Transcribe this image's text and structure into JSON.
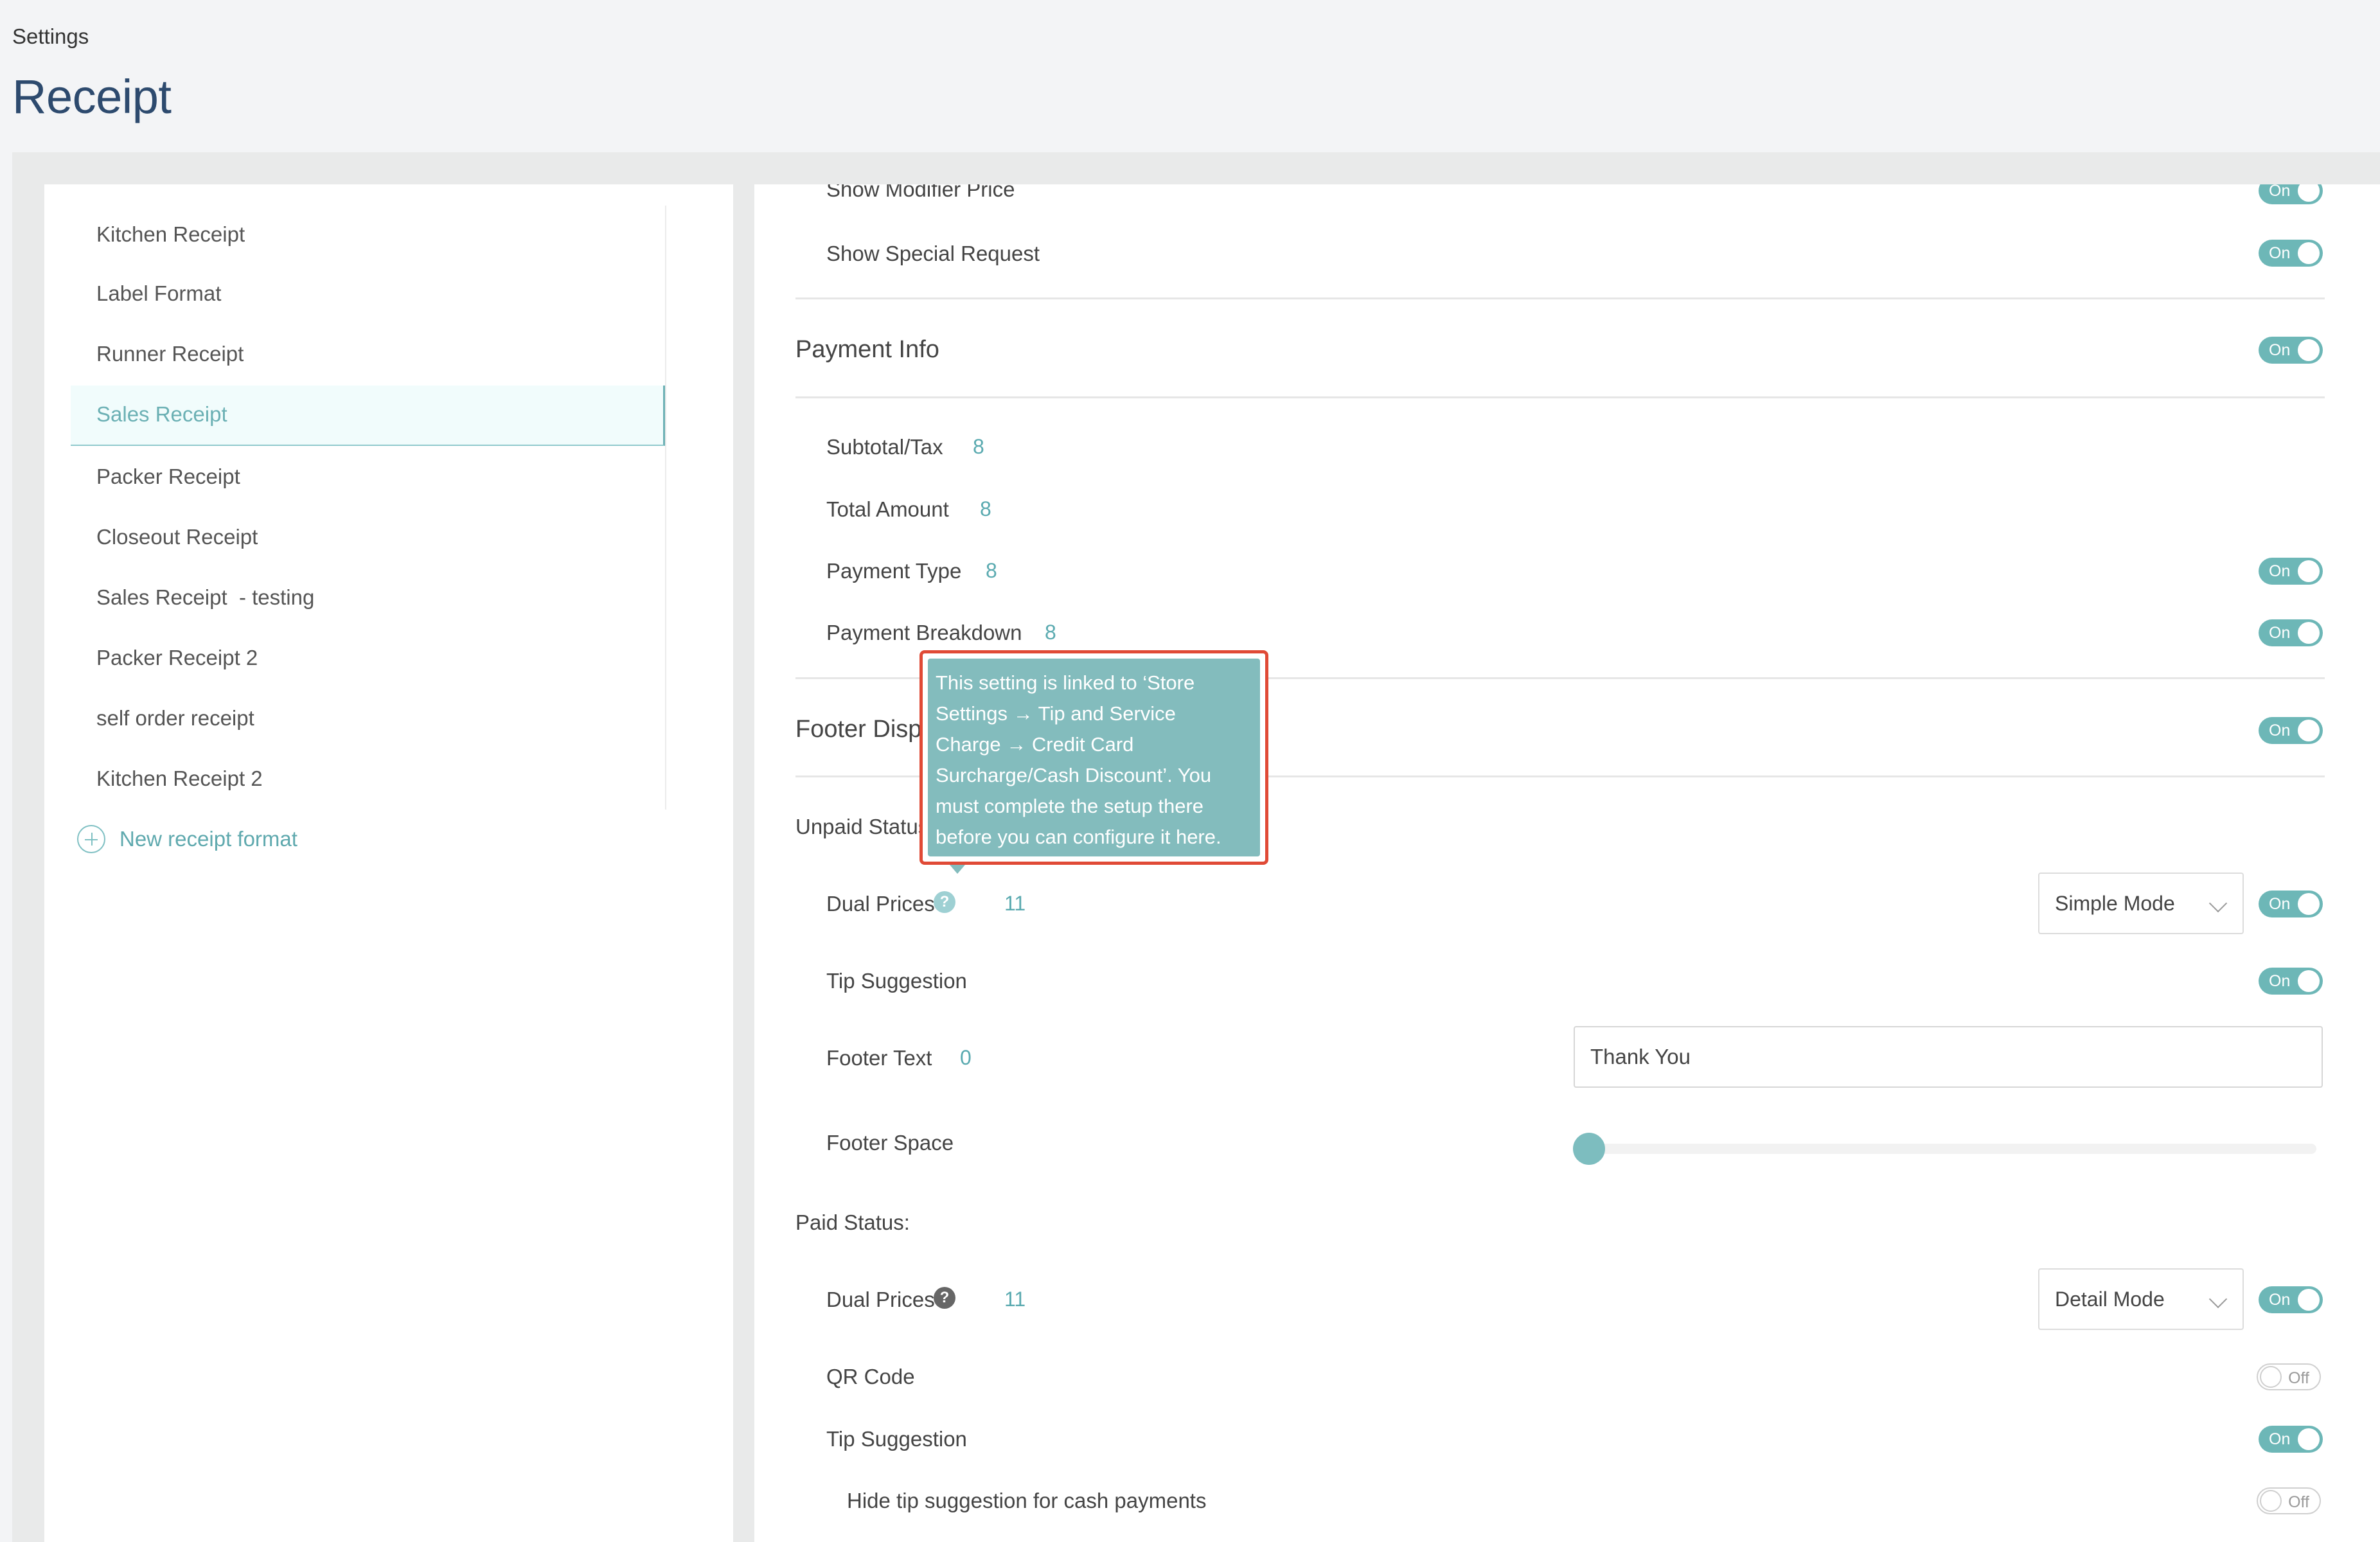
{
  "header": {
    "breadcrumb": "Settings",
    "title": "Receipt"
  },
  "sidebar": {
    "items": [
      {
        "label": "Kitchen Receipt"
      },
      {
        "label": "Label Format"
      },
      {
        "label": "Runner Receipt"
      },
      {
        "label": "Sales Receipt",
        "active": true
      },
      {
        "label": "Packer Receipt"
      },
      {
        "label": "Closeout Receipt"
      },
      {
        "label": "Sales Receipt  - testing"
      },
      {
        "label": "Packer Receipt 2"
      },
      {
        "label": "self order receipt"
      },
      {
        "label": "Kitchen Receipt 2"
      }
    ],
    "new_format_label": "New receipt format"
  },
  "toggle_text": {
    "on": "On",
    "off": "Off"
  },
  "main": {
    "show_modifier_price": {
      "label": "Show Modifier Price",
      "state": "On"
    },
    "show_special_request": {
      "label": "Show Special Request",
      "state": "On"
    },
    "payment_info": {
      "title": "Payment Info",
      "state": "On",
      "subtotal_tax": {
        "label": "Subtotal/Tax",
        "value": "8"
      },
      "total_amount": {
        "label": "Total Amount",
        "value": "8"
      },
      "payment_type": {
        "label": "Payment Type",
        "value": "8",
        "state": "On"
      },
      "payment_breakdown": {
        "label": "Payment Breakdown",
        "value": "8",
        "state": "On"
      }
    },
    "footer_display": {
      "title": "Footer Displa",
      "state": "On",
      "unpaid_status": {
        "label": "Unpaid Status:",
        "dual_prices": {
          "label": "Dual Prices",
          "value": "11",
          "mode": "Simple Mode",
          "state": "On"
        },
        "tip_suggestion": {
          "label": "Tip Suggestion",
          "state": "On"
        },
        "footer_text": {
          "label": "Footer Text",
          "value": "0",
          "input_value": "Thank You"
        },
        "footer_space": {
          "label": "Footer Space",
          "level": 0
        }
      },
      "paid_status": {
        "label": "Paid Status:",
        "dual_prices": {
          "label": "Dual Prices",
          "value": "11",
          "mode": "Detail Mode",
          "state": "On"
        },
        "qr_code": {
          "label": "QR Code",
          "state": "Off"
        },
        "tip_suggestion": {
          "label": "Tip Suggestion",
          "state": "On"
        },
        "hide_tip_cash": {
          "label": "Hide tip suggestion for cash payments",
          "state": "Off"
        }
      }
    },
    "tooltip": {
      "lines": [
        "This setting is linked to ‘Store",
        "Settings → Tip and Service",
        "Charge → Credit Card",
        "Surcharge/Cash Discount’. You",
        "must complete the setup there",
        "before you can configure it here."
      ]
    }
  },
  "colors": {
    "accent": "#6db7b7",
    "title": "#2d4a6e",
    "tooltip_border": "#e04a36",
    "tooltip_bg": "#83bcbd"
  }
}
